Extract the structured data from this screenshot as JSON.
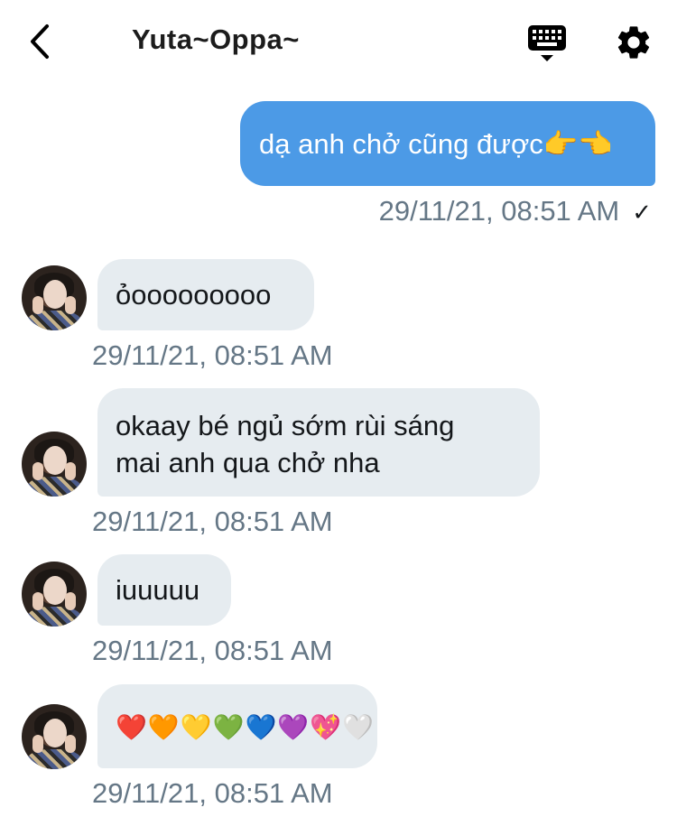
{
  "header": {
    "title": "Yuta~Oppa~"
  },
  "messages": [
    {
      "direction": "sent",
      "text": "dạ anh chở cũng được👉👈",
      "timestamp": "29/11/21, 08:51 AM",
      "status": "✓"
    },
    {
      "direction": "received",
      "text": "ỏooooooooo",
      "timestamp": "29/11/21, 08:51 AM"
    },
    {
      "direction": "received",
      "lines": [
        "okaay bé ngủ sớm rùi sáng",
        "mai anh qua chở nha"
      ],
      "timestamp": "29/11/21, 08:51 AM"
    },
    {
      "direction": "received",
      "text": "iuuuuu",
      "timestamp": "29/11/21, 08:51 AM"
    },
    {
      "direction": "received",
      "emojis": [
        "❤️",
        "🧡",
        "💛",
        "💚",
        "💙",
        "💜",
        "💖",
        "🤍"
      ],
      "timestamp": "29/11/21, 08:51 AM"
    }
  ],
  "colors": {
    "sent_bubble": "#4c9ae6",
    "received_bubble": "#e6ecf0",
    "timestamp": "#657786"
  },
  "icons": {
    "back": "chevron-left-icon",
    "keyboard": "keyboard-icon",
    "settings": "gear-icon"
  }
}
